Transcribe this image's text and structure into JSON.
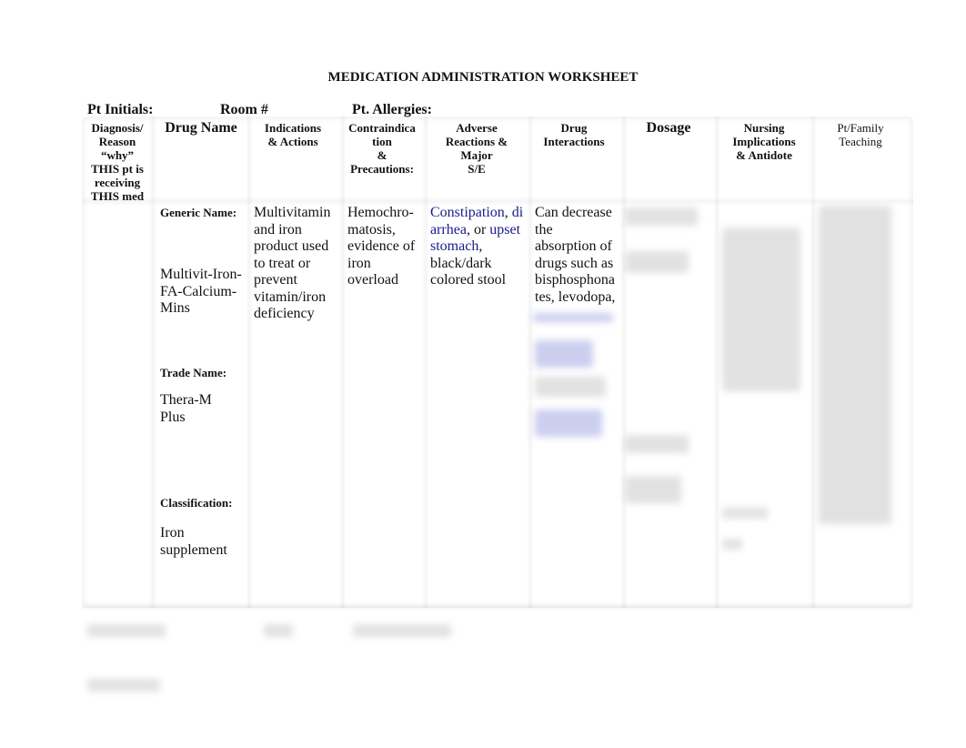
{
  "document": {
    "title": "MEDICATION ADMINISTRATION WORKSHEET",
    "patient_fields": {
      "initials_label": "Pt Initials:",
      "room_label": "Room #",
      "allergies_label": "Pt. Allergies:"
    }
  },
  "table": {
    "headers": {
      "diagnosis": [
        "Diagnosis/",
        "Reason",
        "“why”",
        "THIS pt is",
        "receiving",
        "THIS med"
      ],
      "drug_name": "Drug Name",
      "indications": [
        "Indications",
        "& Actions"
      ],
      "contraindications": [
        "Contraindica",
        "tion",
        "&",
        "Precautions:"
      ],
      "adverse": [
        "Adverse",
        "Reactions &",
        "Major",
        "S/E"
      ],
      "interactions": [
        "Drug",
        "Interactions"
      ],
      "dosage": "Dosage",
      "nursing": [
        "Nursing",
        "Implications",
        "& Antidote"
      ],
      "teaching": [
        "Pt/Family",
        "Teaching"
      ]
    },
    "drug": {
      "generic_label": "Generic Name:",
      "generic_value": [
        "Multivit-Iron-",
        "FA-Calcium-",
        "Mins"
      ],
      "trade_label": "Trade Name:",
      "trade_value": [
        "Thera-M",
        "Plus"
      ],
      "classification_label": "Classification:",
      "classification_value": [
        "Iron",
        "supplement"
      ]
    },
    "indications": [
      "Multivitamin",
      "and iron",
      "product used",
      "to treat or",
      "prevent",
      "vitamin/iron",
      "deficiency"
    ],
    "contraindications": [
      "Hemochro-",
      "matosis,",
      "evidence of",
      "iron",
      "overload"
    ],
    "adverse": {
      "link1a": "Constipation",
      "sep1": ", ",
      "link2a": "di",
      "link2b": "arrhea",
      "sep2": ", or ",
      "link3a": "upset",
      "link3b": "stomach",
      "sep3": ",",
      "rest": [
        "black/dark",
        "colored stool"
      ]
    },
    "interactions": [
      "Can decrease",
      "the",
      "absorption of",
      "drugs such as",
      "bisphosphona",
      "tes, levodopa,"
    ],
    "link_color": "#1a1a8c"
  }
}
